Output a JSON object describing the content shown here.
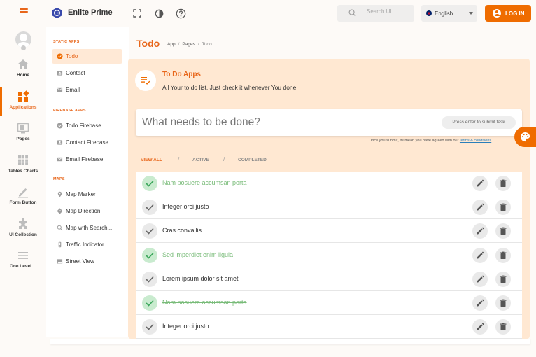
{
  "header": {
    "brand": "Enlite Prime",
    "search_placeholder": "Search UI",
    "language": "English",
    "login_label": "LOG IN"
  },
  "rail": [
    {
      "label": "Home",
      "icon": "home-icon"
    },
    {
      "label": "Applications",
      "icon": "apps-icon",
      "active": true
    },
    {
      "label": "Pages",
      "icon": "pages-icon"
    },
    {
      "label": "Tables Charts",
      "icon": "tables-icon"
    },
    {
      "label": "Form Button",
      "icon": "form-icon"
    },
    {
      "label": "UI Collection",
      "icon": "puzzle-icon"
    },
    {
      "label": "One Level ...",
      "icon": "menu-icon"
    }
  ],
  "submenu": {
    "static_title": "STATIC APPS",
    "static_items": [
      "Todo",
      "Contact",
      "Email"
    ],
    "firebase_title": "FIREBASE APPS",
    "firebase_items": [
      "Todo Firebase",
      "Contact Firebase",
      "Email Firebase"
    ],
    "maps_title": "MAPS",
    "maps_items": [
      "Map Marker",
      "Map Direction",
      "Map with Search...",
      "Traffic Indicator",
      "Street View"
    ]
  },
  "page": {
    "title": "Todo",
    "breadcrumb": [
      "App",
      "Pages",
      "Todo"
    ]
  },
  "panel": {
    "title": "To Do Apps",
    "description": "All Your to do list. Just check it whenever You done.",
    "input_placeholder": "What needs to be done?",
    "hint": "Press enter to submit task",
    "terms_text": "Once you submit, its mean you have agreed with our",
    "terms_link": "terms & conditions"
  },
  "filters": {
    "all": "VIEW ALL",
    "active": "ACTIVE",
    "completed": "COMPLETED",
    "separator": "/"
  },
  "todos": [
    {
      "text": "Nam posuere accumsan porta",
      "done": true
    },
    {
      "text": "Integer orci justo",
      "done": false
    },
    {
      "text": "Cras convallis",
      "done": false
    },
    {
      "text": "Sed imperdiet enim ligula",
      "done": true
    },
    {
      "text": "Lorem ipsum dolor sit amet",
      "done": false
    },
    {
      "text": "Nam posuere accumsan porta",
      "done": true
    },
    {
      "text": "Integer orci justo",
      "done": false
    }
  ],
  "colors": {
    "accent": "#ef6c00",
    "panel_bg": "#ffe8d2",
    "done_text": "#78bb78"
  }
}
